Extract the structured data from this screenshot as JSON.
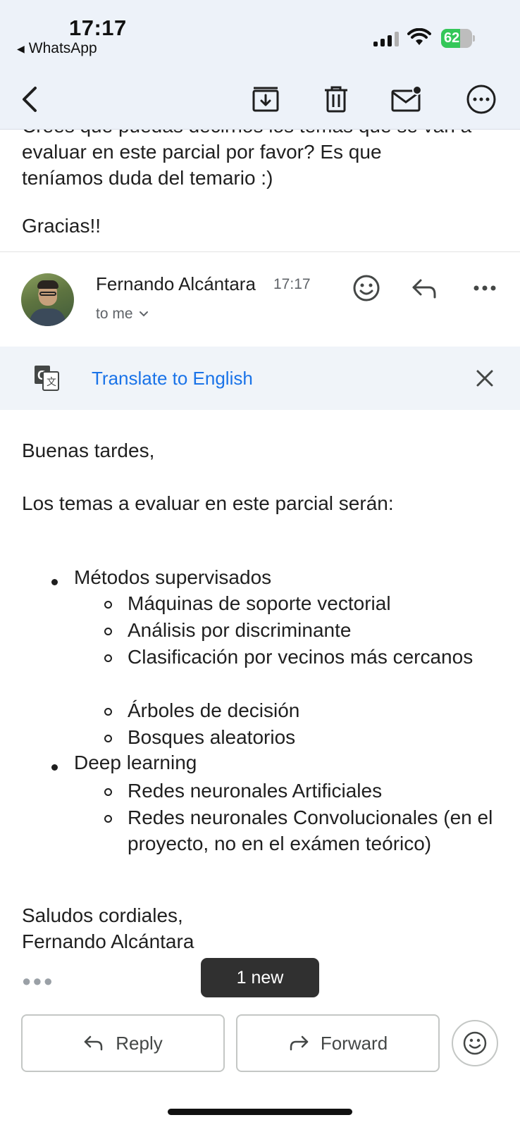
{
  "status_bar": {
    "time": "17:17",
    "back_app": "WhatsApp",
    "battery": "62",
    "battery_level": 0.62
  },
  "toolbar": {
    "icons": [
      "back-arrow-icon",
      "archive-icon",
      "delete-icon",
      "mark-unread-icon",
      "more-options-icon"
    ]
  },
  "previous_message": {
    "lines": [
      "Crees que puedas decirnos los temas que se van a",
      "evaluar en este parcial por favor? Es que",
      "teníamos duda del temario :)"
    ],
    "closing": "Gracias!!"
  },
  "message": {
    "sender": "Fernando Alcántara",
    "time": "17:17",
    "recipient": "to me",
    "translate_label": "Translate to English",
    "greeting": "Buenas tardes,",
    "intro": "Los temas a evaluar en este parcial serán:",
    "topics": [
      {
        "title": "Métodos supervisados",
        "items": [
          "Máquinas de soporte vectorial",
          "Análisis por discriminante",
          "Clasificación por vecinos más cercanos",
          "Árboles de decisión",
          "Bosques aleatorios"
        ]
      },
      {
        "title": "Deep learning",
        "items": [
          "Redes neuronales Artificiales",
          "Redes neuronales Convolucionales (en el proyecto, no en el exámen teórico)"
        ]
      }
    ],
    "signoff": "Saludos cordiales,",
    "signature": "Fernando Alcántara"
  },
  "new_badge": "1 new",
  "actions": {
    "reply": "Reply",
    "forward": "Forward"
  },
  "colors": {
    "accent_link": "#1a73e8",
    "toolbar_bg": "#edf2f9",
    "battery_green": "#34c759"
  }
}
